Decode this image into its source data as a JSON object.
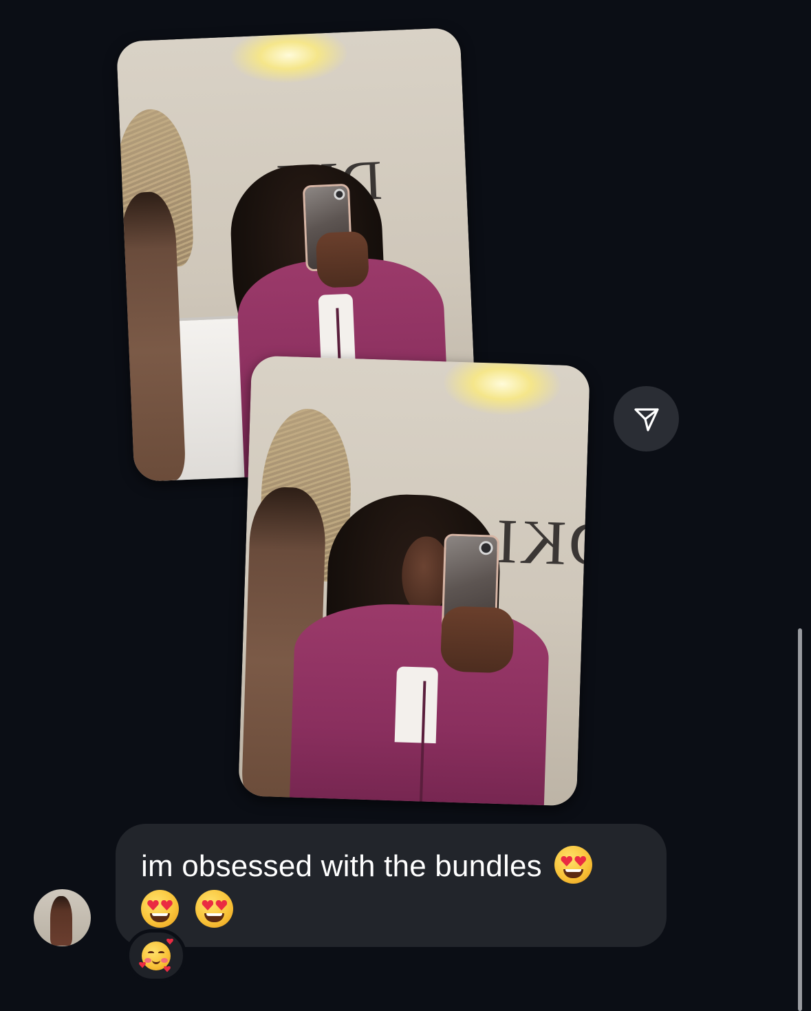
{
  "conversation": {
    "message": {
      "text": "im obsessed with the bundles",
      "emojis": [
        "smiling-face-with-heart-eyes",
        "smiling-face-with-heart-eyes",
        "smiling-face-with-heart-eyes"
      ]
    },
    "reaction": {
      "emoji": "smiling-face-with-hearts"
    },
    "photos": [
      {
        "wall_logo": "DKI"
      },
      {
        "wall_logo": "DKI"
      }
    ],
    "forward_button": {
      "icon": "send-icon"
    }
  },
  "colors": {
    "background": "#0b0e15",
    "bubble": "#22252b",
    "button": "#2a2d34",
    "text": "#ffffff"
  }
}
